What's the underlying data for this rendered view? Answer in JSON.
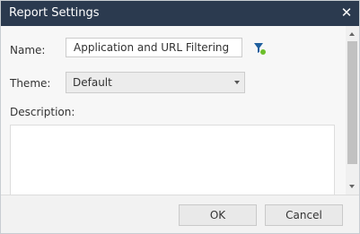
{
  "dialog": {
    "title": "Report Settings",
    "close_icon": "close-icon"
  },
  "form": {
    "name_label": "Name:",
    "name_value": "Application and URL Filtering",
    "filter_icon": "filter-icon",
    "colors": {
      "filter_icon": "#1f5f9e",
      "filter_dot": "#6cbf2b"
    },
    "theme_label": "Theme:",
    "theme_value": "Default",
    "description_label": "Description:",
    "description_value": ""
  },
  "footer": {
    "ok_label": "OK",
    "cancel_label": "Cancel"
  }
}
